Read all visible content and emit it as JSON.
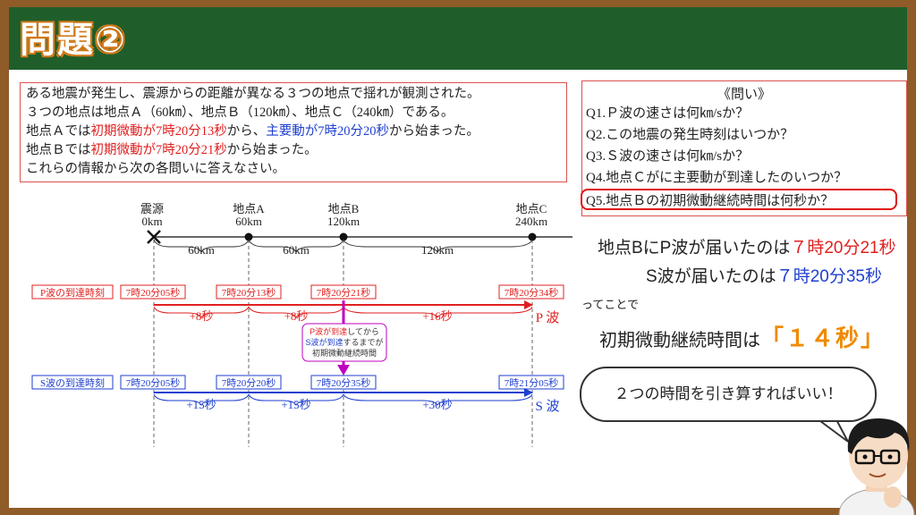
{
  "title": "問題②",
  "problem": {
    "line1": "ある地震が発生し、震源からの距離が異なる３つの地点で揺れが観測された。",
    "line2": "３つの地点は地点Ａ（60㎞）、地点Ｂ（120㎞）、地点Ｃ（240㎞）である。",
    "line3_a": "地点Ａでは",
    "line3_b": "初期微動が7時20分13秒",
    "line3_c": "から、",
    "line3_d": "主要動が7時20分20秒",
    "line3_e": "から始まった。",
    "line4_a": "地点Ｂでは",
    "line4_b": "初期微動が7時20分21秒",
    "line4_c": "から始まった。",
    "line5": "これらの情報から次の各問いに答えなさい。"
  },
  "questions": {
    "header": "《問い》",
    "q1": "Q1.Ｐ波の速さは何㎞/sか？",
    "q2": "Q2.この地震の発生時刻はいつか？",
    "q3": "Q3.Ｓ波の速さは何㎞/sか？",
    "q4": "Q4.地点Ｃがに主要動が到達したのいつか？",
    "q5": "Q5.地点Ｂの初期微動継続時間は何秒か？"
  },
  "timeline": {
    "points": [
      {
        "name": "震源",
        "dist": "0km"
      },
      {
        "name": "地点A",
        "dist": "60km"
      },
      {
        "name": "地点B",
        "dist": "120km"
      },
      {
        "name": "地点C",
        "dist": "240km"
      }
    ],
    "segments": [
      "60km",
      "60km",
      "120km"
    ],
    "p_row_label": "P波の到達時刻",
    "p_times": [
      "7時20分05秒",
      "7時20分13秒",
      "7時20分21秒",
      "7時20分34秒"
    ],
    "p_diffs": [
      "+8秒",
      "+8秒",
      "+16秒"
    ],
    "p_wave": "P 波",
    "s_row_label": "S波の到達時刻",
    "s_times": [
      "7時20分05秒",
      "7時20分20秒",
      "7時20分35秒",
      "7時21分05秒"
    ],
    "s_diffs": [
      "+15秒",
      "+15秒",
      "+30秒"
    ],
    "s_wave": "S 波",
    "callout_l1a": "P波が到達",
    "callout_l1b": "してから",
    "callout_l2a": "S波が到達",
    "callout_l2b": "するまでが",
    "callout_l3": "初期微動継続時間"
  },
  "statements": {
    "p_prefix": "地点BにP波が届いたのは",
    "p_time": "７時20分21秒",
    "s_prefix": "S波が届いたのは",
    "s_time": "７時20分35秒",
    "tte": "ってことで",
    "answer_prefix": "初期微動継続時間は",
    "answer_value": "「１４秒」",
    "bubble": "２つの時間を引き算すればいい！"
  },
  "colors": {
    "p_wave": "#e02020",
    "s_wave": "#1e3fcf",
    "callout": "#c000c0",
    "answer": "#f08a00",
    "board_header": "#1f5e2a"
  }
}
